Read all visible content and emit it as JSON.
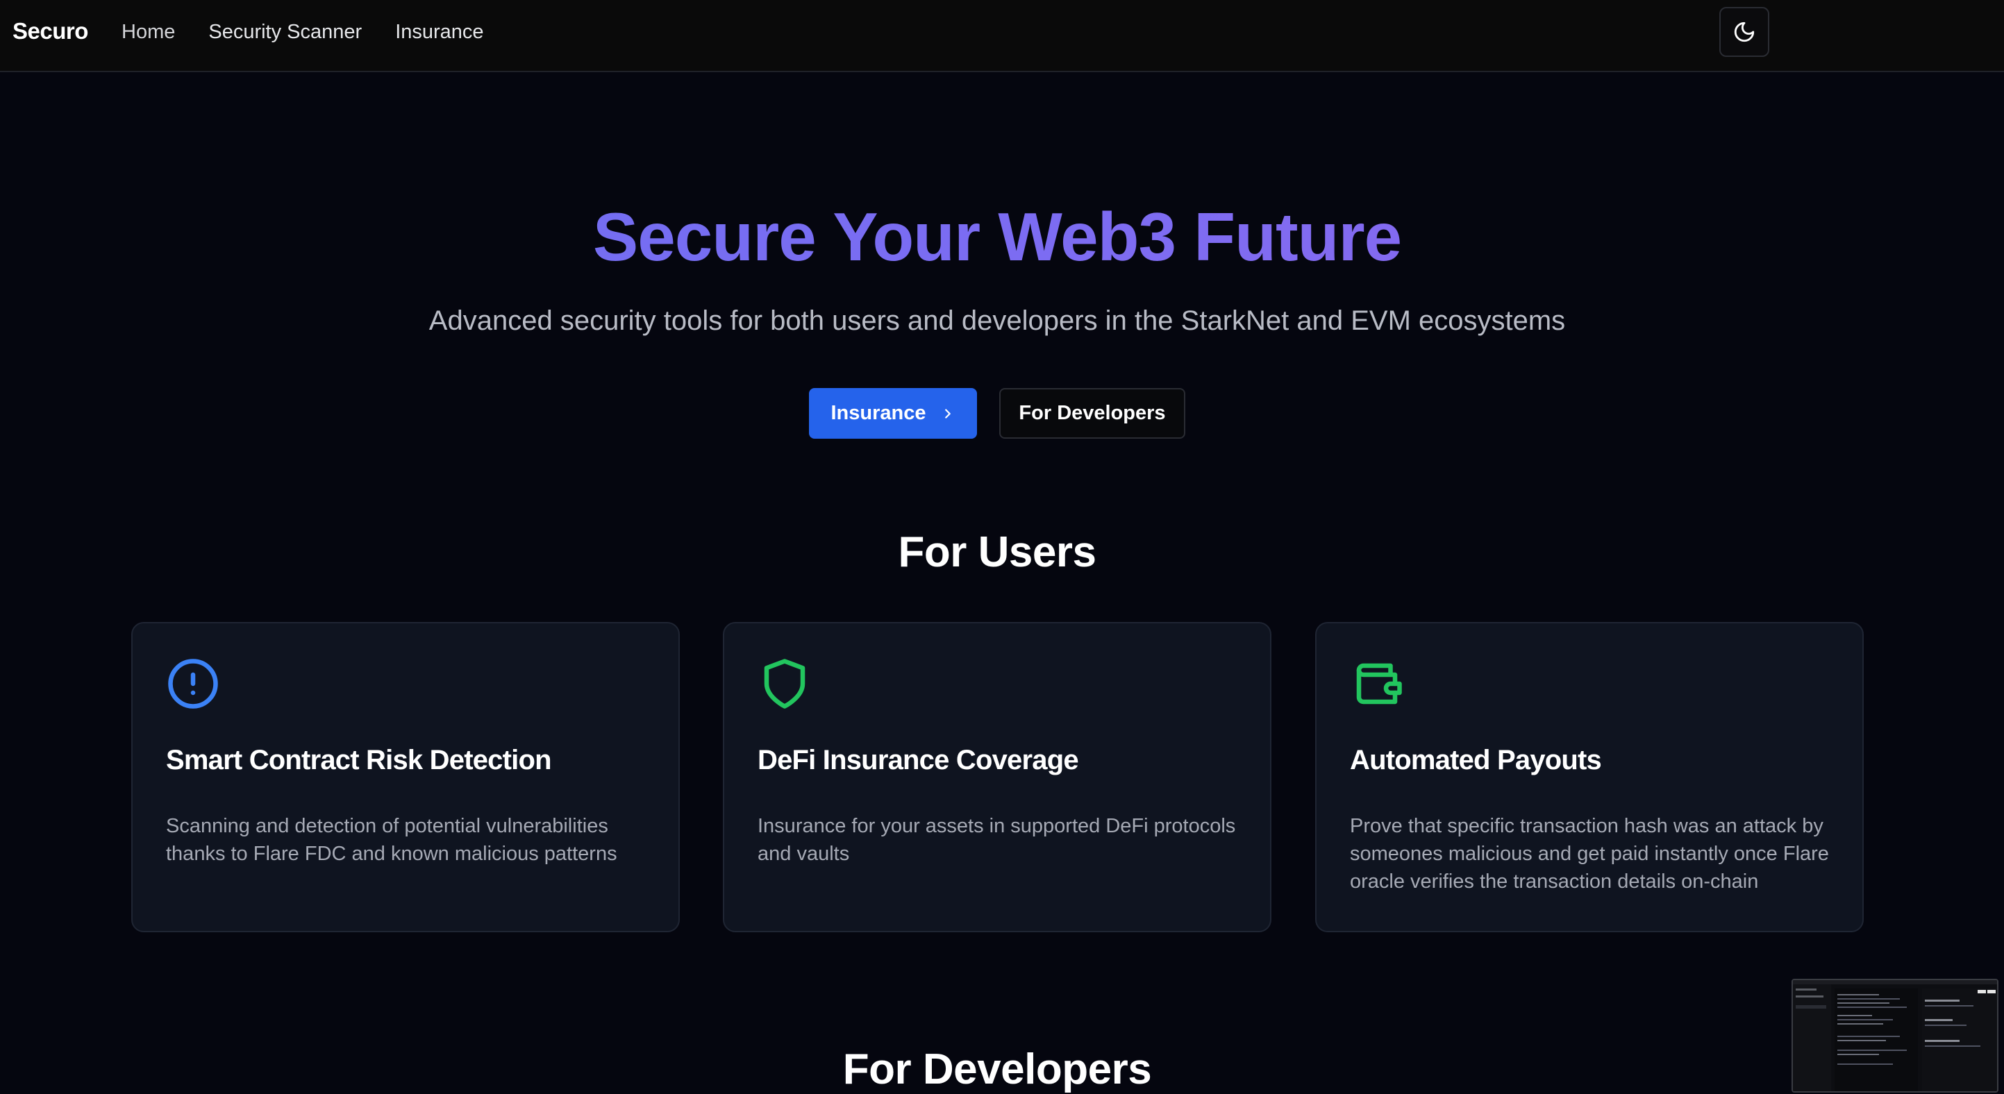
{
  "navbar": {
    "brand": "Securo",
    "links": [
      "Home",
      "Security Scanner",
      "Insurance"
    ],
    "theme_toggle_icon": "moon-icon"
  },
  "hero": {
    "title": "Secure Your Web3 Future",
    "subtitle": "Advanced security tools for both users and developers in the StarkNet and EVM ecosystems",
    "primary_button": "Insurance",
    "primary_button_icon": "chevron-right-icon",
    "secondary_button": "For Developers",
    "title_gradient": [
      "#6b6ff3",
      "#8f67ee"
    ]
  },
  "users_section": {
    "title": "For Users",
    "cards": [
      {
        "icon": "alert-circle-icon",
        "icon_color": "#3b82f6",
        "title": "Smart Contract Risk Detection",
        "description": "Scanning and detection of potential vulnerabilities thanks to Flare FDC and known malicious patterns"
      },
      {
        "icon": "shield-icon",
        "icon_color": "#22c55e",
        "title": "DeFi Insurance Coverage",
        "description": "Insurance for your assets in supported DeFi protocols and vaults"
      },
      {
        "icon": "wallet-icon",
        "icon_color": "#22c55e",
        "title": "Automated Payouts",
        "description": "Prove that specific transaction hash was an attack by someones malicious and get paid instantly once Flare oracle verifies the transaction details on-chain"
      }
    ]
  },
  "developers_section": {
    "title": "For Developers"
  },
  "colors": {
    "background": "#05060f",
    "navbar": "#0a0a0a",
    "card": "#0f1420",
    "primary": "#2563eb"
  }
}
